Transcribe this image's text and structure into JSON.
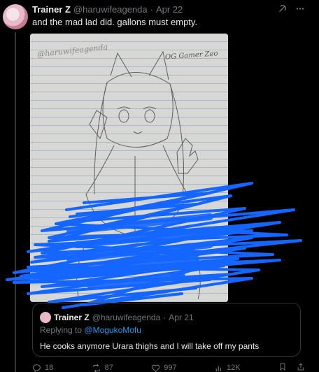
{
  "tweet": {
    "author_name": "Trainer Z",
    "author_handle": "@haruwifeagenda",
    "date": "Apr 22",
    "separator": "·",
    "text": "and the mad lad did. gallons must empty."
  },
  "photo": {
    "watermark": "@haruwifeagenda",
    "signature": "OG Gamer Zeo"
  },
  "quote": {
    "author_name": "Trainer Z",
    "author_handle": "@haruwifeagenda",
    "date": "Apr 21",
    "separator": "·",
    "replying_label": "Replying to",
    "replying_to": "@MogukoMofu",
    "text": "He cooks anymore Urara thighs and I will take off my pants"
  },
  "actions": {
    "replies": "18",
    "reposts": "87",
    "likes": "997",
    "views": "12K"
  },
  "icons": {
    "top": [
      "grok-icon",
      "more-icon"
    ],
    "actions": [
      "reply-icon",
      "repost-icon",
      "like-icon",
      "views-icon",
      "bookmark-icon",
      "share-icon"
    ]
  },
  "colors": {
    "background": "#000000",
    "text": "#e7e9ea",
    "muted": "#71767b",
    "link": "#1d9bf0",
    "scribble": "#1466ff"
  }
}
